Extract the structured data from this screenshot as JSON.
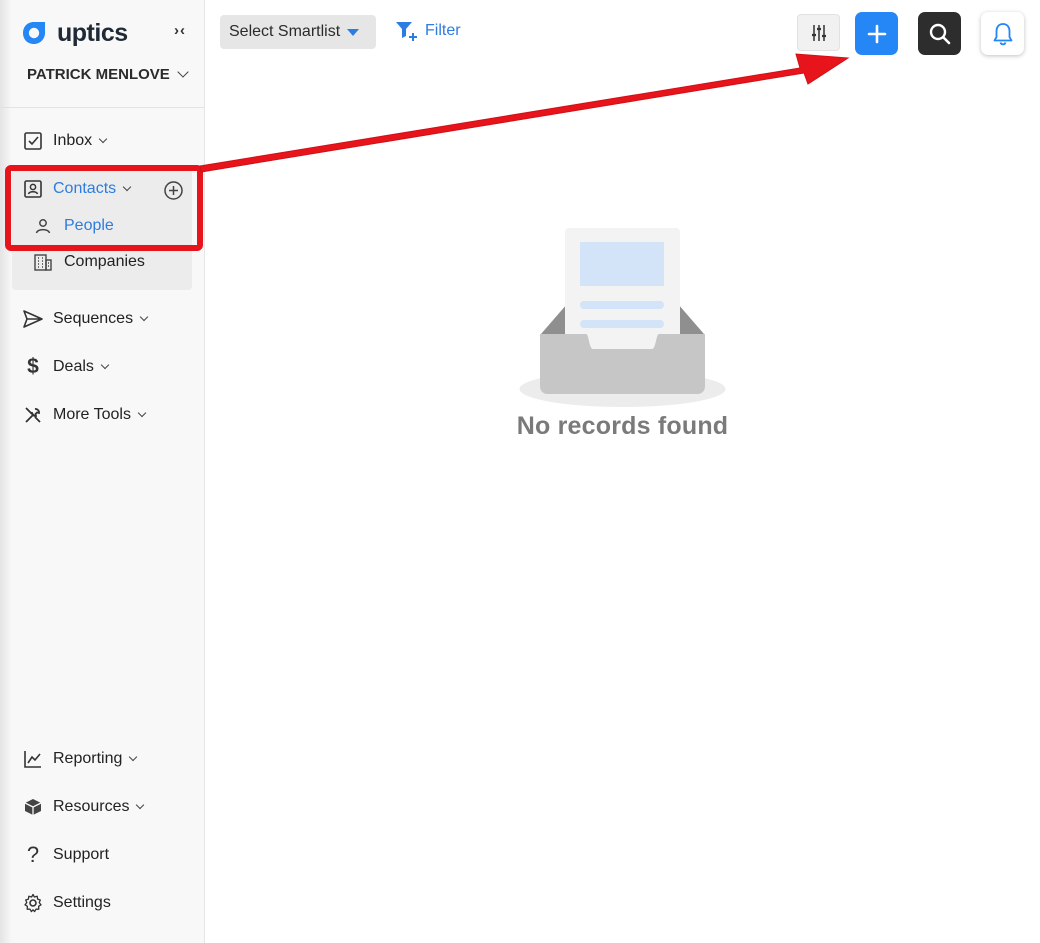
{
  "brand": {
    "name": "uptics",
    "accent": "#2487f5"
  },
  "sidebar": {
    "collapse_glyph": "›‹",
    "account_name": "PATRICK MENLOVE",
    "items": [
      {
        "key": "inbox",
        "label": "Inbox",
        "icon": "checkbox-icon"
      },
      {
        "key": "contacts",
        "label": "Contacts",
        "icon": "contact-card-icon",
        "active": true
      },
      {
        "key": "sequences",
        "label": "Sequences",
        "icon": "send-icon"
      },
      {
        "key": "deals",
        "label": "Deals",
        "icon": "dollar-icon"
      },
      {
        "key": "more_tools",
        "label": "More Tools",
        "icon": "tools-icon"
      },
      {
        "key": "reporting",
        "label": "Reporting",
        "icon": "line-chart-icon"
      },
      {
        "key": "resources",
        "label": "Resources",
        "icon": "cube-icon"
      },
      {
        "key": "support",
        "label": "Support",
        "icon": "question-icon"
      },
      {
        "key": "settings",
        "label": "Settings",
        "icon": "gear-icon"
      }
    ],
    "contacts_sub": [
      {
        "label": "People",
        "icon": "person-icon",
        "active": true
      },
      {
        "label": "Companies",
        "icon": "building-icon"
      }
    ]
  },
  "toolbar": {
    "smartlist_label": "Select Smartlist",
    "filter_label": "Filter"
  },
  "empty_state": {
    "message": "No records found"
  },
  "annotation": {
    "color": "#e8141b"
  }
}
